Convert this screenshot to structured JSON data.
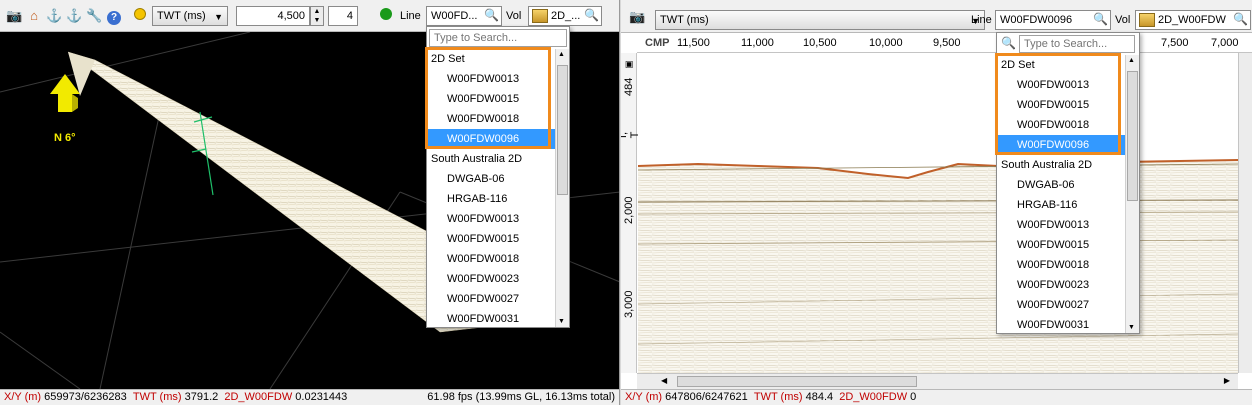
{
  "left": {
    "toolbar": {
      "domain_combo": "TWT (ms)",
      "depth_value": "4,500",
      "step_value": "4",
      "line_label": "Line",
      "line_combo": "W00FD...",
      "vol_label": "Vol",
      "vol_combo": "2D_..."
    },
    "compass": {
      "label": "N 6°"
    },
    "dropdown": {
      "search_placeholder": "Type to Search...",
      "group1": "2D Set",
      "group1_items": [
        "W00FDW0013",
        "W00FDW0015",
        "W00FDW0018",
        "W00FDW0096"
      ],
      "group2": "South Australia 2D",
      "group2_items": [
        "DWGAB-06",
        "HRGAB-116",
        "W00FDW0013",
        "W00FDW0015",
        "W00FDW0018",
        "W00FDW0023",
        "W00FDW0027",
        "W00FDW0031"
      ]
    },
    "status": {
      "xy_label": "X/Y (m)",
      "xy_value": "659973/6236283",
      "twt_label": "TWT (ms)",
      "twt_value": "3791.2",
      "vol_label": "2D_W00FDW",
      "vol_value": "0.0231443",
      "fps": "61.98 fps (13.99ms GL, 16.13ms total)"
    }
  },
  "right": {
    "toolbar": {
      "domain_combo": "TWT (ms)",
      "line_label": "Line",
      "line_combo": "W00FDW0096",
      "vol_label": "Vol",
      "vol_combo": "2D_W00FDW"
    },
    "axis": {
      "cmp_label": "CMP",
      "cmp_ticks": [
        "11,500",
        "11,000",
        "10,500",
        "10,000",
        "9,500",
        "7,500"
      ],
      "cmp_extra": "7,000",
      "twt_axis_label": "I, T",
      "twt_cursor": "484",
      "twt_ticks": [
        "2,000",
        "3,000"
      ]
    },
    "dropdown": {
      "search_placeholder": "Type to Search...",
      "group1": "2D Set",
      "group1_items": [
        "W00FDW0013",
        "W00FDW0015",
        "W00FDW0018",
        "W00FDW0096"
      ],
      "group2": "South Australia 2D",
      "group2_items": [
        "DWGAB-06",
        "HRGAB-116",
        "W00FDW0013",
        "W00FDW0015",
        "W00FDW0018",
        "W00FDW0023",
        "W00FDW0027",
        "W00FDW0031"
      ]
    },
    "status": {
      "xy_label": "X/Y (m)",
      "xy_value": "647806/6247621",
      "twt_label": "TWT (ms)",
      "twt_value": "484.4",
      "vol_label": "2D_W00FDW",
      "vol_value": "0"
    }
  },
  "colors": {
    "accent": "#3399ff",
    "highlight": "#f08a1c",
    "status_red": "#c00000",
    "line_dot": "#1a9a1a"
  }
}
